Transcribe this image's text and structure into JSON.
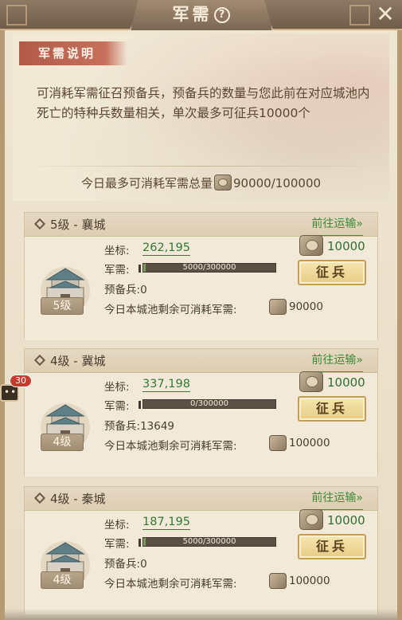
{
  "window": {
    "title": "军需",
    "help_icon": "?",
    "close_icon": "✕"
  },
  "description": {
    "tag": "军需说明",
    "text": "可消耗军需征召预备兵，预备兵的数量与您此前在对应城池内死亡的特种兵数量相关，单次最多可征兵10000个"
  },
  "daily_total": {
    "label": "今日最多可消耗军需总量",
    "used": "90000",
    "separator": "/",
    "max": "100000"
  },
  "cities": [
    {
      "title": "5级 - 襄城",
      "goto_label": "前往运输»",
      "coord_label": "坐标:",
      "coord": "262,195",
      "supply_label": "军需:",
      "supply_text": "5000/300000",
      "supply_fraction": 0.0167,
      "reserve_label": "预备兵:",
      "reserve": "0",
      "remain_label": "今日本城池剩余可消耗军需:",
      "remain": "90000",
      "cost": "10000",
      "button_label": "征兵",
      "level_badge": "5级"
    },
    {
      "title": "4级 - 冀城",
      "goto_label": "前往运输»",
      "coord_label": "坐标:",
      "coord": "337,198",
      "supply_label": "军需:",
      "supply_text": "0/300000",
      "supply_fraction": 0,
      "reserve_label": "预备兵:",
      "reserve": "13649",
      "remain_label": "今日本城池剩余可消耗军需:",
      "remain": "100000",
      "cost": "10000",
      "button_label": "征兵",
      "level_badge": "4级"
    },
    {
      "title": "4级 - 秦城",
      "goto_label": "前往运输»",
      "coord_label": "坐标:",
      "coord": "187,195",
      "supply_label": "军需:",
      "supply_text": "5000/300000",
      "supply_fraction": 0.0167,
      "reserve_label": "预备兵:",
      "reserve": "0",
      "remain_label": "今日本城池剩余可消耗军需:",
      "remain": "100000",
      "cost": "10000",
      "button_label": "征兵",
      "level_badge": "4级"
    }
  ],
  "side": {
    "badge_count": "30"
  },
  "colors": {
    "accent_green": "#2f7a35",
    "tag_red": "#b25a4a",
    "button_gold": "#e7cc85"
  }
}
